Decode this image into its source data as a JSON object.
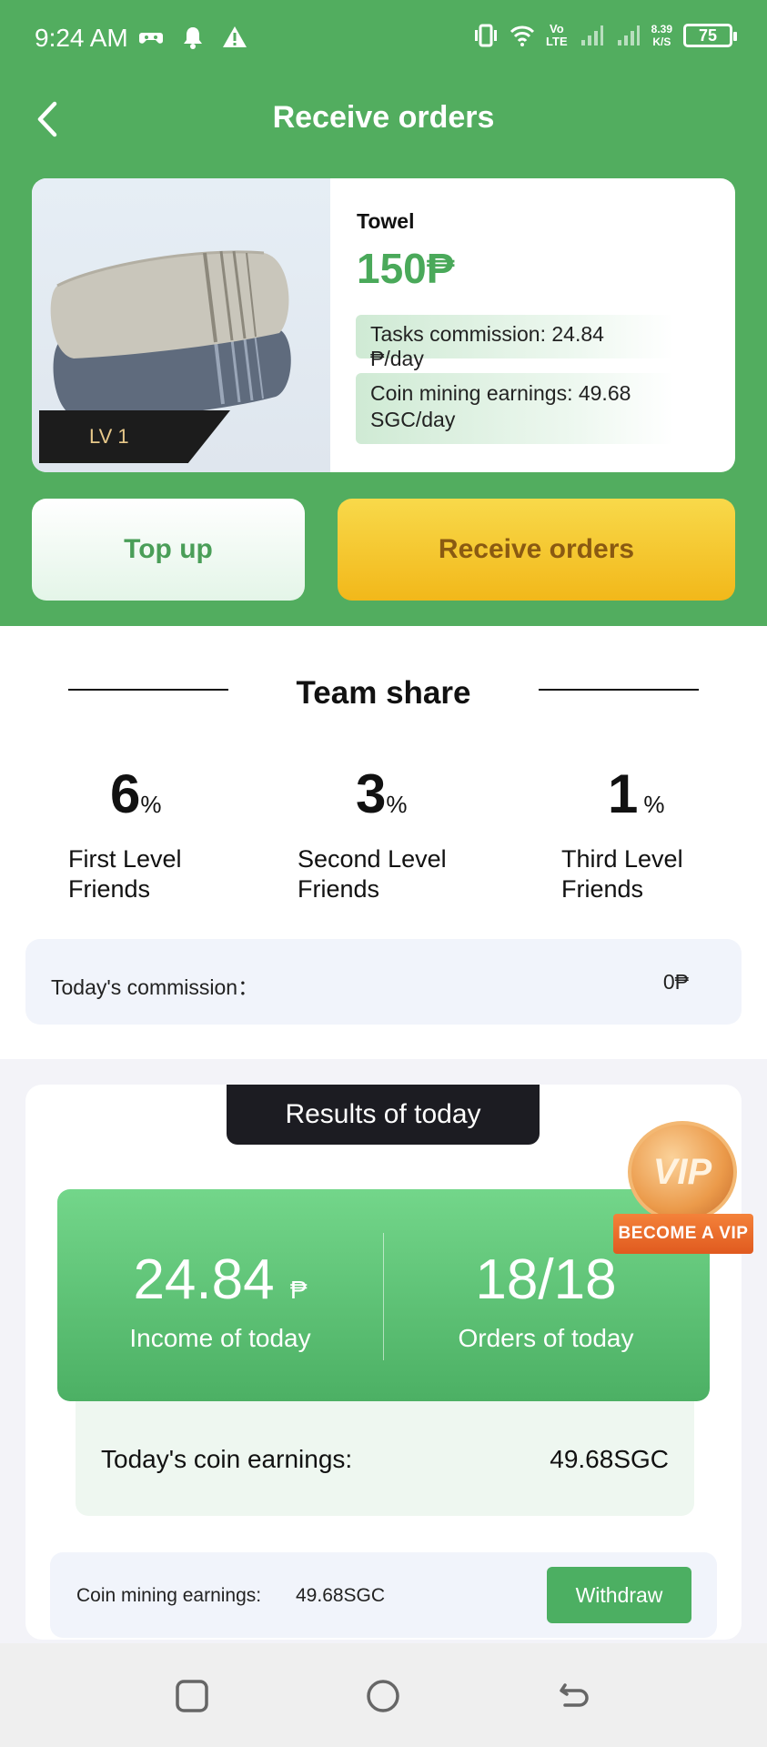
{
  "status_bar": {
    "time": "9:24 AM",
    "net_speed_value": "8.39",
    "net_speed_unit": "K/S",
    "vo_lte_top": "Vo",
    "vo_lte_bottom": "LTE",
    "battery": "75"
  },
  "header": {
    "title": "Receive orders"
  },
  "product": {
    "name": "Towel",
    "price": "150₱",
    "level": "LV 1",
    "tasks_commission": "Tasks commission:  24.84 ₱/day",
    "coin_mining": "Coin mining earnings:   49.68 SGC/day"
  },
  "actions": {
    "top_up": "Top up",
    "receive_orders": "Receive orders"
  },
  "team_share": {
    "title": "Team share",
    "levels": [
      {
        "percent": "6",
        "unit": "%",
        "label_line1": "First Level",
        "label_line2": "Friends"
      },
      {
        "percent": "3",
        "unit": "%",
        "label_line1": "Second Level",
        "label_line2": "Friends"
      },
      {
        "percent": "1",
        "unit": "%",
        "label_line1": "Third Level",
        "label_line2": "Friends"
      }
    ],
    "commission_label": "Today's commission：",
    "commission_value": "0₱"
  },
  "results": {
    "tab_label": "Results of today",
    "income_value": "24.84",
    "income_currency": "₱",
    "income_label": "Income of today",
    "orders_value": "18/18",
    "orders_label": "Orders of today",
    "coin_earnings_label": "Today's coin earnings:",
    "coin_earnings_value": "49.68SGC",
    "mining_label": "Coin mining earnings:",
    "mining_value": "49.68SGC",
    "withdraw": "Withdraw"
  },
  "vip": {
    "coin_text": "VIP",
    "ribbon": "BECOME A VIP"
  },
  "colors": {
    "header_green": "#52ad5f",
    "price_green": "#4aa95a",
    "yellow_button": "#f2b81a",
    "dark_tab": "#1c1c22",
    "vip_orange": "#e05a1f"
  }
}
